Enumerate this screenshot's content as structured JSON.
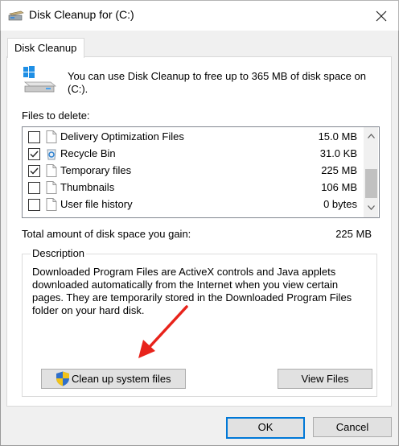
{
  "window": {
    "title": "Disk Cleanup for  (C:)"
  },
  "tab": {
    "label": "Disk Cleanup"
  },
  "intro": "You can use Disk Cleanup to free up to 365 MB of disk space on (C:).",
  "files_label": "Files to delete:",
  "files": [
    {
      "name": "Delivery Optimization Files",
      "size": "15.0 MB",
      "checked": false,
      "icon": "file-icon"
    },
    {
      "name": "Recycle Bin",
      "size": "31.0 KB",
      "checked": true,
      "icon": "recycle-bin-icon"
    },
    {
      "name": "Temporary files",
      "size": "225 MB",
      "checked": true,
      "icon": "file-icon"
    },
    {
      "name": "Thumbnails",
      "size": "106 MB",
      "checked": false,
      "icon": "file-icon"
    },
    {
      "name": "User file history",
      "size": "0 bytes",
      "checked": false,
      "icon": "file-icon"
    }
  ],
  "total": {
    "label": "Total amount of disk space you gain:",
    "value": "225 MB"
  },
  "description": {
    "legend": "Description",
    "text": "Downloaded Program Files are ActiveX controls and Java applets downloaded automatically from the Internet when you view certain pages. They are temporarily stored in the Downloaded Program Files folder on your hard disk."
  },
  "buttons": {
    "cleanup_system": "Clean up system files",
    "view_files": "View Files",
    "ok": "OK",
    "cancel": "Cancel"
  },
  "colors": {
    "accent": "#0078d7",
    "annotation_arrow": "#e8231b"
  }
}
